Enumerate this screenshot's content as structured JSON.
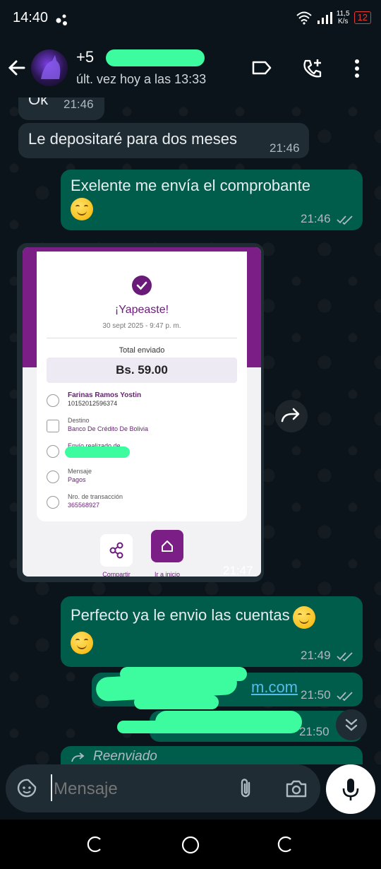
{
  "status_bar": {
    "time": "14:40",
    "net_speed_value": "11,5",
    "net_speed_unit": "K/s",
    "battery": "12"
  },
  "header": {
    "contact_name": "+5",
    "last_seen": "últ. vez hoy a las 13:33"
  },
  "messages": [
    {
      "text": "Ok",
      "time": "21:46"
    },
    {
      "text": "Le depositaré para dos meses",
      "time": "21:46"
    },
    {
      "text": "Exelente me envía el comprobante",
      "time": "21:46"
    },
    {
      "time": "21:47"
    },
    {
      "text": "Perfecto ya le envio las cuentas",
      "time": "21:49"
    },
    {
      "text": "m.com",
      "time": "21:50"
    },
    {
      "time": "21:50"
    },
    {
      "text": "Reenviado"
    }
  ],
  "receipt": {
    "title": "¡Yapeaste!",
    "date": "30 sept 2025 - 9:47 p. m.",
    "total_label": "Total enviado",
    "amount": "Bs. 59.00",
    "recipient_name": "Farinas Ramos Yostin",
    "recipient_number": "10152012596374",
    "destino_label": "Destino",
    "destino_value": "Banco De Crédito De Bolivia",
    "sender_label": "Envío realizado de",
    "mensaje_label": "Mensaje",
    "mensaje_value": "Pagos",
    "tx_label": "Nro. de transacción",
    "tx_value": "365568927",
    "share_label": "Compartir",
    "home_label": "Ir a inicio"
  },
  "input": {
    "placeholder": "Mensaje"
  },
  "colors": {
    "incoming": "#202c33",
    "outgoing": "#005c4b",
    "yape_purple": "#7b1f86",
    "redaction": "#3dfca0"
  }
}
